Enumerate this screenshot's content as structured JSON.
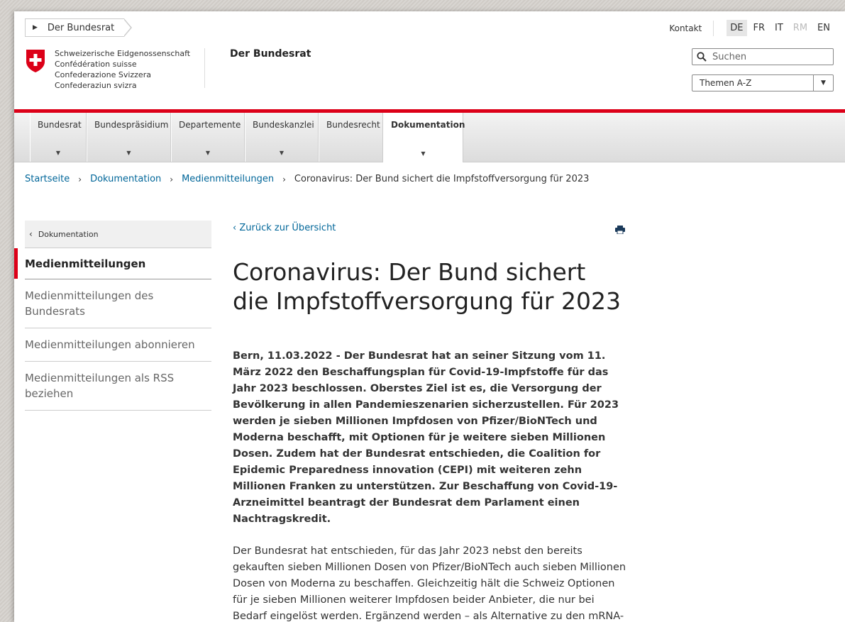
{
  "header": {
    "breadcrumb_top": "Der Bundesrat",
    "kontakt": "Kontakt",
    "languages": [
      {
        "code": "DE",
        "state": "active"
      },
      {
        "code": "FR",
        "state": "normal"
      },
      {
        "code": "IT",
        "state": "normal"
      },
      {
        "code": "RM",
        "state": "disabled"
      },
      {
        "code": "EN",
        "state": "normal"
      }
    ],
    "logo_lines": [
      "Schweizerische Eidgenossenschaft",
      "Confédération suisse",
      "Confederazione Svizzera",
      "Confederaziun svizra"
    ],
    "site_title": "Der Bundesrat",
    "search_placeholder": "Suchen",
    "themes_label": "Themen A-Z",
    "brand_color": "#dc0018"
  },
  "nav": {
    "items": [
      "Bundesrat",
      "Bundespräsidium",
      "Departemente",
      "Bundeskanzlei",
      "Bundesrecht",
      "Dokumentation"
    ],
    "active": "Dokumentation"
  },
  "breadcrumbs": {
    "links": [
      "Startseite",
      "Dokumentation",
      "Medienmitteilungen"
    ],
    "current": "Coronavirus: Der Bund sichert die Impfstoffversorgung für 2023"
  },
  "sidebar": {
    "back_label": "Dokumentation",
    "active": "Medienmitteilungen",
    "items": [
      "Medienmitteilungen des Bundesrats",
      "Medienmitteilungen abonnieren",
      "Medienmitteilungen als RSS beziehen"
    ]
  },
  "article": {
    "back_link": "Zurück zur Übersicht",
    "title": "Coronavirus: Der Bund sichert die Impfstoffversorgung für 2023",
    "lead": "Bern, 11.03.2022 - Der Bundesrat hat an seiner Sitzung vom 11. März 2022 den Beschaffungsplan für Covid-19-Impfstoffe für das Jahr 2023 beschlossen. Oberstes Ziel ist es, die Versorgung der Bevölkerung in allen Pandemieszenarien sicherzustellen. Für 2023 werden je sieben Millionen Impfdosen von Pfizer/BioNTech und Moderna beschafft, mit Optionen für je weitere sieben Millionen Dosen. Zudem hat der Bundesrat entschieden, die Coalition for Epidemic Preparedness innovation (CEPI) mit weiteren zehn Millionen Franken zu unterstützen. Zur Beschaffung von Covid-19-Arzneimittel beantragt der Bundesrat dem Parlament einen Nachtragskredit.",
    "body": "Der Bundesrat hat entschieden, für das Jahr 2023 nebst den bereits gekauften sieben Millionen Dosen von Pfizer/BioNTech auch sieben Millionen Dosen von Moderna zu beschaffen. Gleichzeitig hält die Schweiz Optionen für je sieben Millionen weiterer Impfdosen beider Anbieter, die nur bei Bedarf eingelöst werden. Ergänzend werden – als Alternative zu den mRNA-Impfstoffen – bei einem weiteren Impfhersteller maximal eine Million"
  }
}
